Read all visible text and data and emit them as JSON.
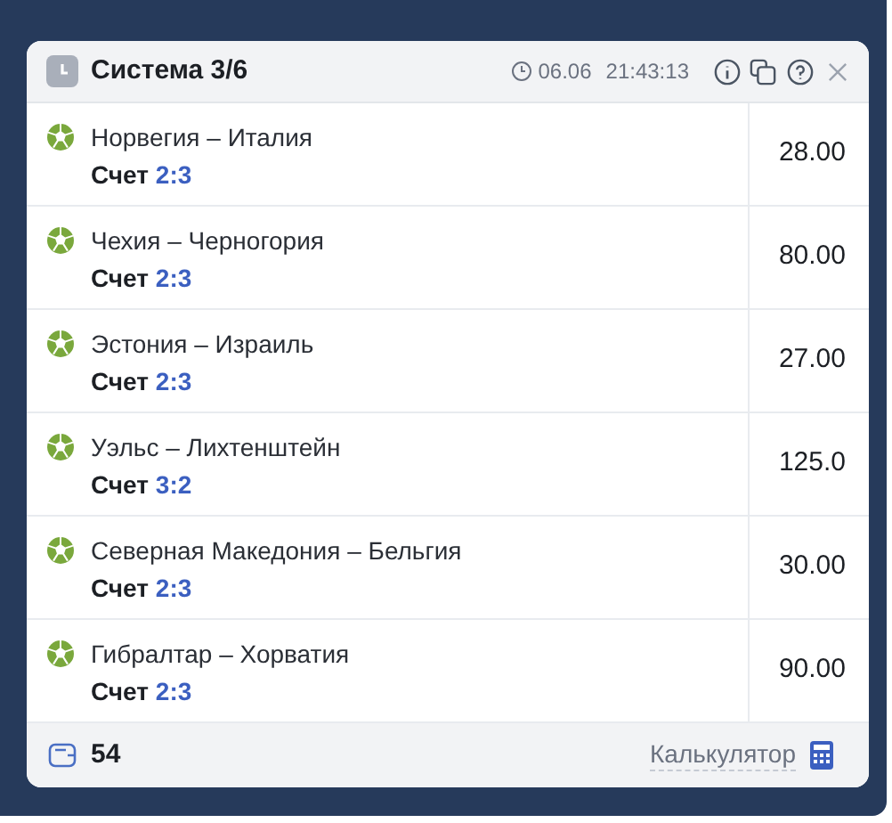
{
  "header": {
    "title": "Система 3/6",
    "date": "06.06",
    "time": "21:43:13"
  },
  "rows": [
    {
      "match": "Норвегия – Италия",
      "score_label": "Счет",
      "score": "2:3",
      "odds": "28.00"
    },
    {
      "match": "Чехия – Черногория",
      "score_label": "Счет",
      "score": "2:3",
      "odds": "80.00"
    },
    {
      "match": "Эстония – Израиль",
      "score_label": "Счет",
      "score": "2:3",
      "odds": "27.00"
    },
    {
      "match": "Уэльс – Лихтенштейн",
      "score_label": "Счет",
      "score": "3:2",
      "odds": "125.0"
    },
    {
      "match": "Северная Македония – Бельгия",
      "score_label": "Счет",
      "score": "2:3",
      "odds": "30.00"
    },
    {
      "match": "Гибралтар – Хорватия",
      "score_label": "Счет",
      "score": "2:3",
      "odds": "90.00"
    }
  ],
  "footer": {
    "amount": "54",
    "calculator": "Калькулятор"
  }
}
